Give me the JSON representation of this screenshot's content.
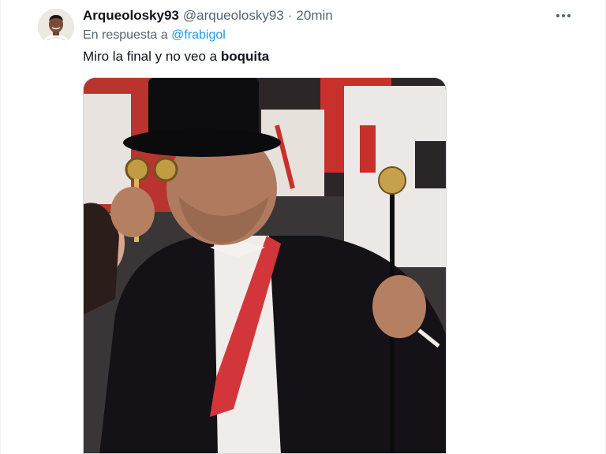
{
  "tweet": {
    "display_name": "Arqueolosky93",
    "handle": "@arqueolosky93",
    "separator": "·",
    "time": "20min",
    "reply_prefix": "En respuesta a",
    "reply_mention": "@frabigol",
    "text_prefix": "Miro la final y no veo a",
    "text_bold": "boquita",
    "more_icon": "ellipsis-icon",
    "media_icon": "photo-media"
  },
  "colors": {
    "link": "#1d9bf0",
    "secondary": "#536471",
    "primary": "#0f1419"
  }
}
